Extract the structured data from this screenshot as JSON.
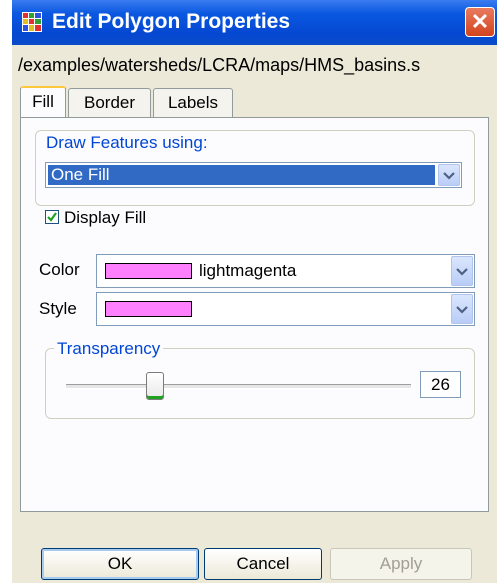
{
  "window": {
    "title": "Edit Polygon Properties",
    "close_glyph": "✕"
  },
  "path_text": "/examples/watersheds/LCRA/maps/HMS_basins.s",
  "tabs": [
    {
      "label": "Fill",
      "active": true
    },
    {
      "label": "Border",
      "active": false
    },
    {
      "label": "Labels",
      "active": false
    }
  ],
  "fill": {
    "draw_features_legend": "Draw Features using:",
    "draw_features_value": "One Fill",
    "display_fill_label": "Display Fill",
    "display_fill_checked": true,
    "color_label": "Color",
    "color_value": "lightmagenta",
    "swatch_color": "#ff80ff",
    "style_label": "Style",
    "transparency_legend": "Transparency",
    "transparency_value": "26"
  },
  "buttons": {
    "ok": "OK",
    "cancel": "Cancel",
    "apply": "Apply"
  },
  "colors": {
    "titlebar": "#0548d2",
    "accent_text": "#0046d5",
    "selection": "#316ac5",
    "panel": "#fcfcfe"
  }
}
